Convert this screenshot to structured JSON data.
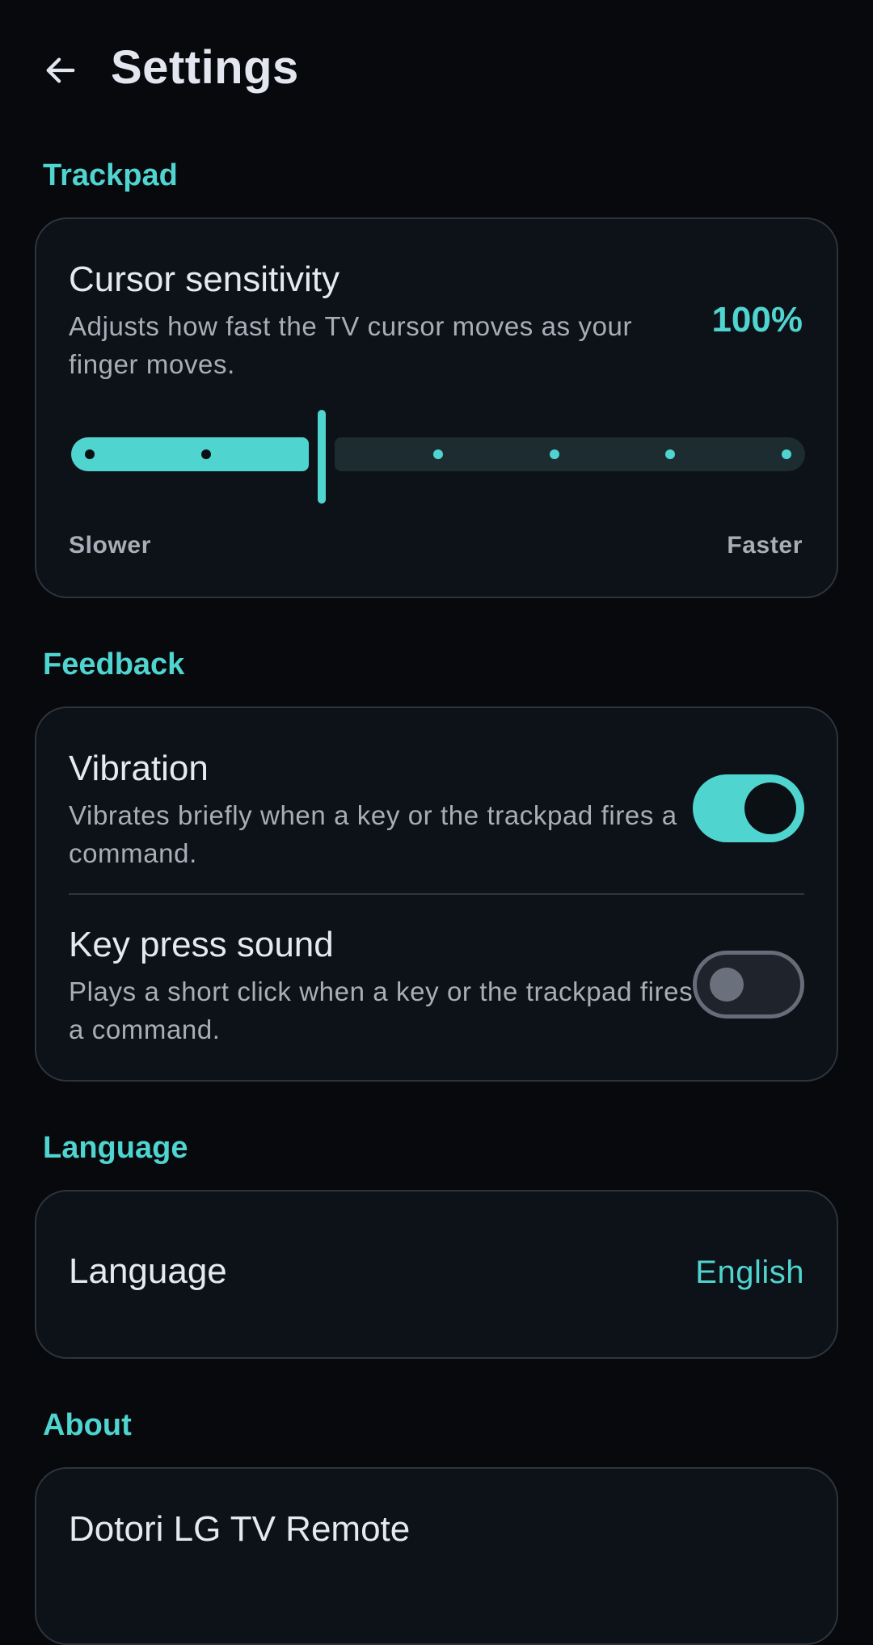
{
  "appbar": {
    "title": "Settings",
    "back_icon": "arrow-left-icon"
  },
  "theme": {
    "accent": "#4fd4cf",
    "background": "#07090d",
    "card": "#0d1118",
    "card_border": "#2e343e"
  },
  "trackpad": {
    "section_label": "Trackpad",
    "cursor_sensitivity": {
      "title": "Cursor sensitivity",
      "description": "Adjusts how fast the TV cursor moves as your finger moves.",
      "value_label": "100%",
      "value_fraction": 0.333,
      "steps": 7,
      "min_label": "Slower",
      "max_label": "Faster"
    }
  },
  "feedback": {
    "section_label": "Feedback",
    "vibration": {
      "title": "Vibration",
      "description": "Vibrates briefly when a key or the trackpad fires a command.",
      "enabled": true
    },
    "key_press_sound": {
      "title": "Key press sound",
      "description": "Plays a short click when a key or the trackpad fires a command.",
      "enabled": false
    }
  },
  "language": {
    "section_label": "Language",
    "row_title": "Language",
    "value": "English"
  },
  "about": {
    "section_label": "About",
    "app_name": "Dotori LG TV Remote"
  }
}
